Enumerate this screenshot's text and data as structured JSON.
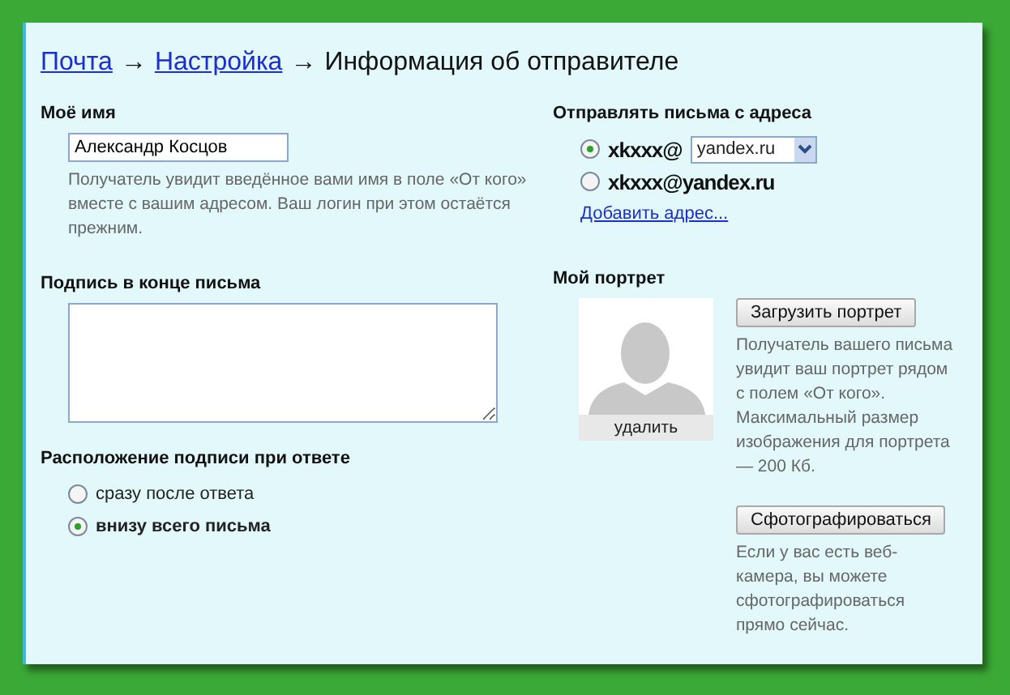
{
  "breadcrumb": [
    {
      "label": "Почта",
      "kind": "link"
    },
    {
      "label": "→",
      "kind": "arrow"
    },
    {
      "label": "Настройка",
      "kind": "link"
    },
    {
      "label": "→",
      "kind": "arrow"
    },
    {
      "label": "Информация об отправителе",
      "kind": "current"
    }
  ],
  "name_section": {
    "title": "Моё имя",
    "value": "Александр Косцов",
    "hint": "Получатель увидит введённое вами имя в поле «От кого» вместе с вашим адресом. Ваш логин при этом остаётся прежним."
  },
  "signature_section": {
    "title": "Подпись в конце письма"
  },
  "placement_section": {
    "title": "Расположение подписи при ответе",
    "options": [
      {
        "label": "сразу после ответа",
        "selected": false
      },
      {
        "label": "внизу всего письма",
        "selected": true
      }
    ]
  },
  "sender_section": {
    "title": "Отправлять письма с адреса",
    "addresses": [
      {
        "kind": "select",
        "login": "xkxxx@",
        "domain": "yandex.ru",
        "selected": true
      },
      {
        "kind": "text",
        "login": "xkxxx@yandex.ru",
        "selected": false
      }
    ],
    "add_link": "Добавить адрес..."
  },
  "portrait_section": {
    "title": "Мой портрет",
    "delete_label": "удалить",
    "upload_button": "Загрузить портрет",
    "upload_hint": "Получатель вашего письма увидит ваш портрет рядом с полем «От кого». Максимальный размер изображения для портрета — 200 Кб.",
    "camera_button": "Сфотографироваться",
    "camera_hint": "Если у вас есть веб-камера, вы можете сфотографироваться прямо сейчас."
  }
}
